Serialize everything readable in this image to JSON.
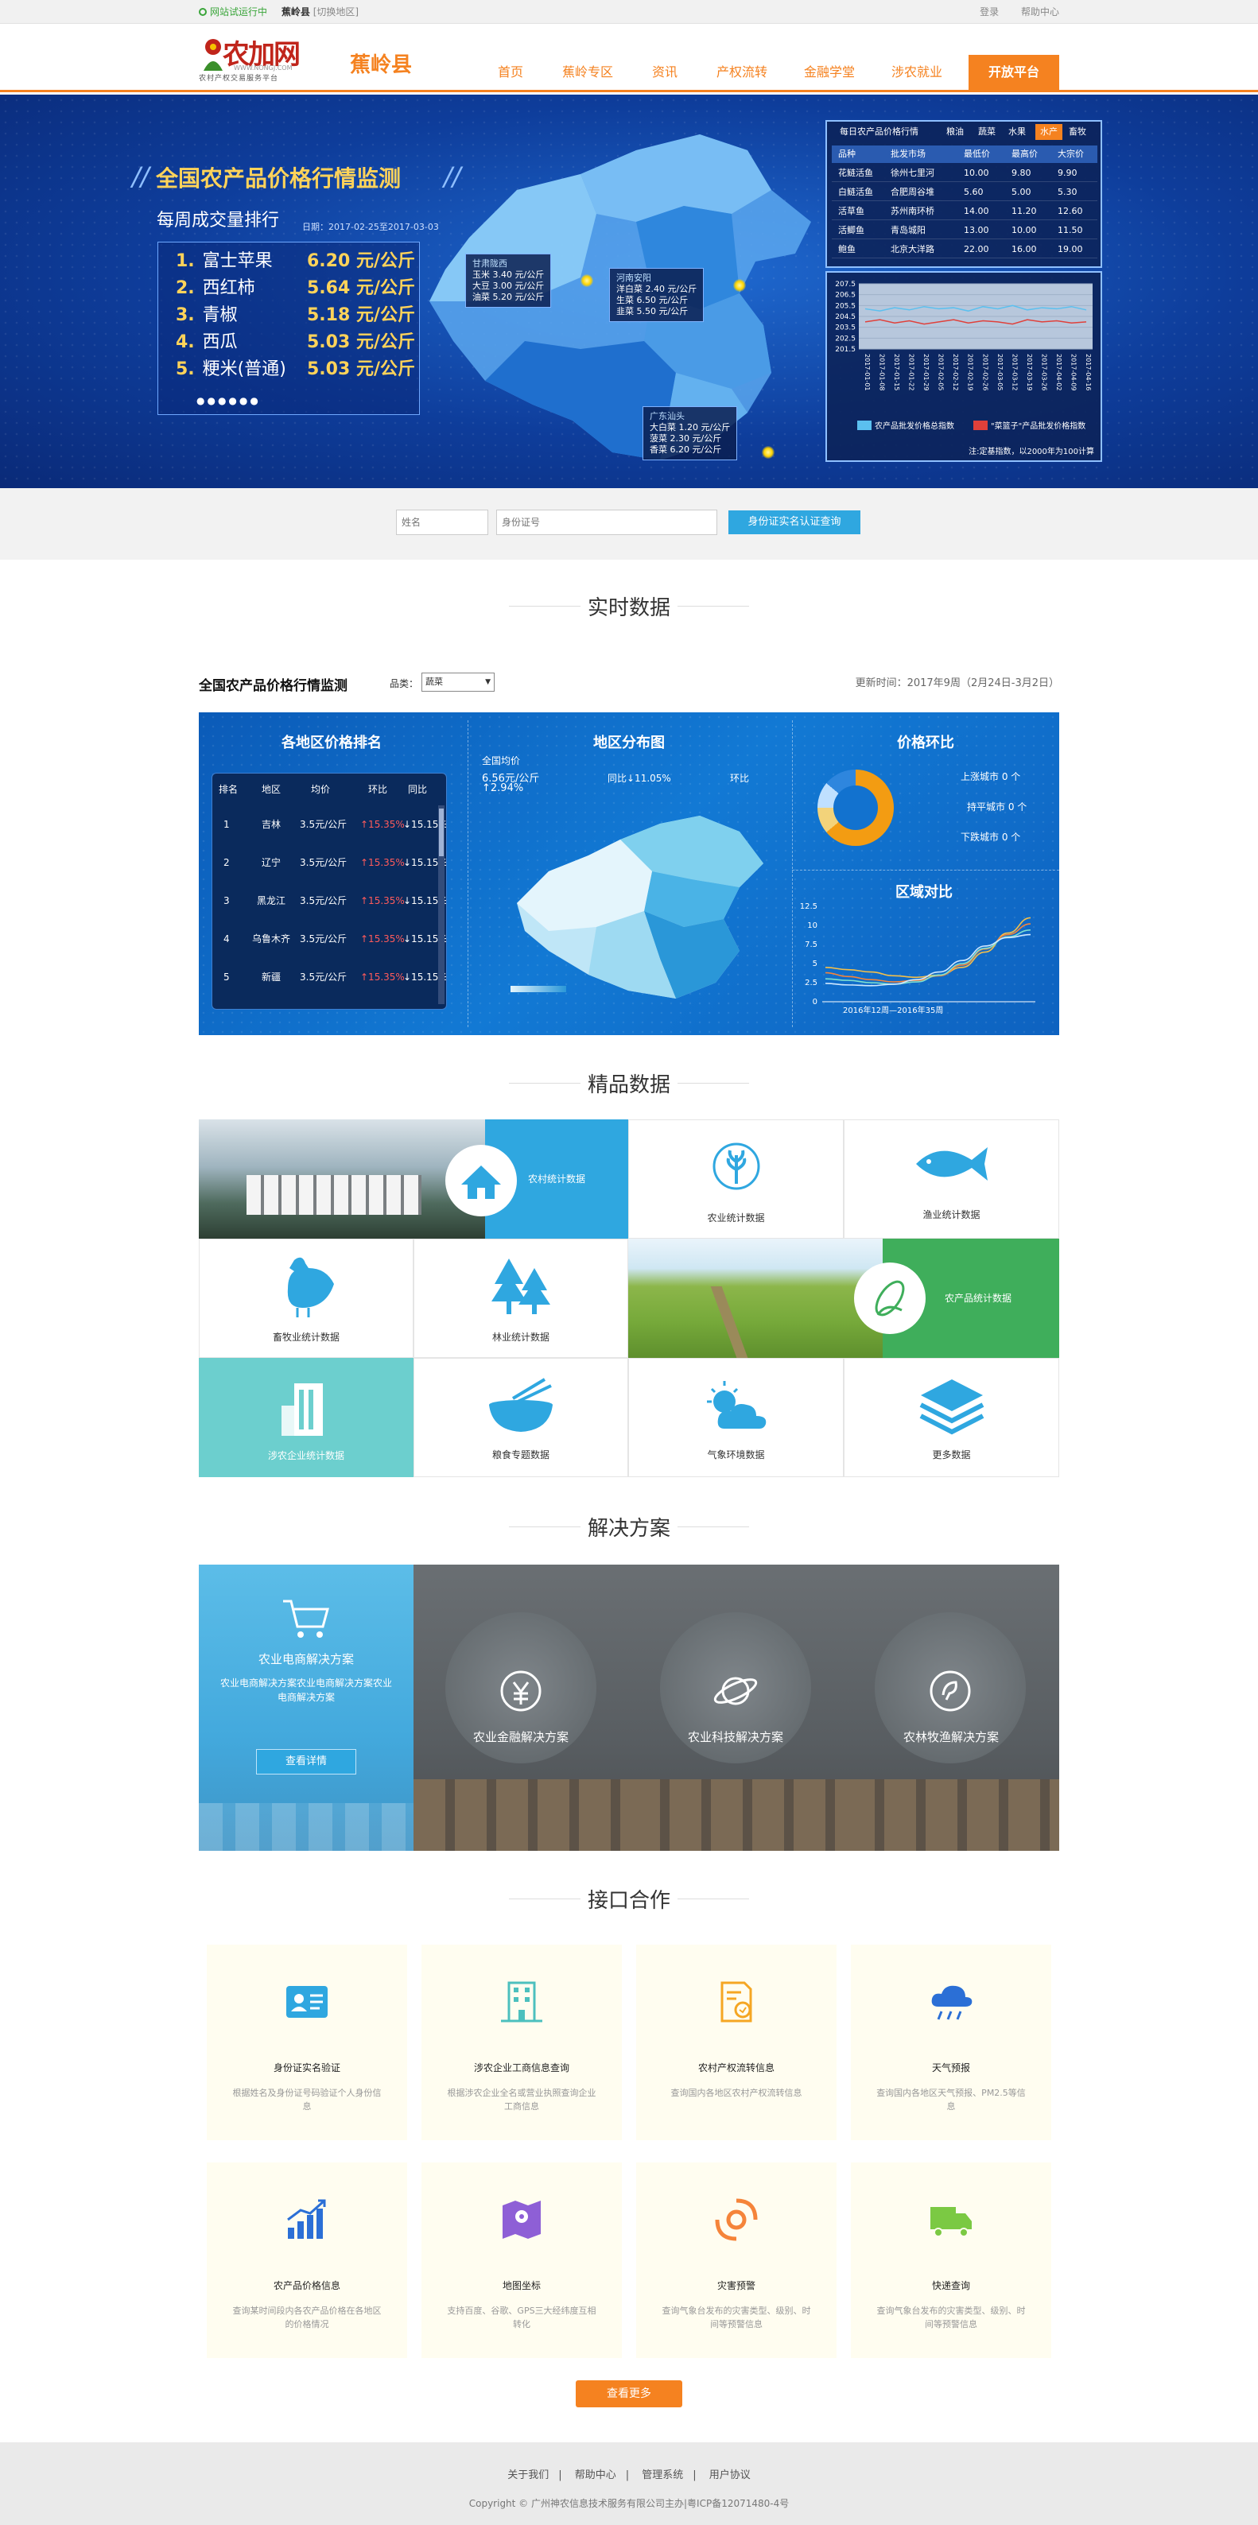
{
  "topbar": {
    "status": "网站试运行中",
    "county": "蕉岭县",
    "switch": "[切换地区]",
    "login": "登录",
    "help": "帮助中心"
  },
  "header": {
    "logo_text": "农加网",
    "logo_url": "WWW.NONGJ.COM",
    "logo_sub": "农村产权交易服务平台",
    "county_title": "蕉岭县",
    "nav": [
      "首页",
      "蕉岭专区",
      "资讯",
      "产权流转",
      "金融学堂",
      "涉农就业",
      "开放平台"
    ],
    "active_nav": "开放平台"
  },
  "banner": {
    "title": "全国农产品价格行情监测",
    "weekly_title": "每周成交量排行",
    "date_range": "日期：2017-02-25至2017-03-03",
    "ranking": [
      {
        "n": "1.",
        "name": "富士苹果",
        "price": "6.20 元/公斤"
      },
      {
        "n": "2.",
        "name": "西红柿",
        "price": "5.64 元/公斤"
      },
      {
        "n": "3.",
        "name": "青椒",
        "price": "5.18 元/公斤"
      },
      {
        "n": "4.",
        "name": "西瓜",
        "price": "5.03 元/公斤"
      },
      {
        "n": "5.",
        "name": "粳米(普通)",
        "price": "5.03 元/公斤"
      }
    ],
    "dots": "●●●●●●",
    "tips": [
      {
        "title": "甘肃陇西",
        "lines": [
          "玉米    3.40 元/公斤",
          "大豆    3.00 元/公斤",
          "油菜    5.20 元/公斤"
        ]
      },
      {
        "title": "河南安阳",
        "lines": [
          "洋白菜    2.40 元/公斤",
          "生菜  6.50 元/公斤",
          "韭菜  5.50 元/公斤"
        ]
      },
      {
        "title": "广东汕头",
        "lines": [
          "大白菜    1.20 元/公斤",
          "菠菜    2.30 元/公斤",
          "香菜    6.20 元/公斤"
        ]
      }
    ],
    "price_panel": {
      "tabs": [
        "每日农产品价格行情",
        "粮油",
        "蔬菜",
        "水果",
        "水产",
        "畜牧"
      ],
      "active_tab": "水产",
      "headers": [
        "品种",
        "批发市场",
        "最低价",
        "最高价",
        "大宗价"
      ],
      "rows": [
        [
          "花鲢活鱼",
          "徐州七里河",
          "10.00",
          "9.80",
          "9.90"
        ],
        [
          "白鲢活鱼",
          "合肥周谷堆",
          "5.60",
          "5.00",
          "5.30"
        ],
        [
          "活草鱼",
          "苏州南环桥",
          "14.00",
          "11.20",
          "12.60"
        ],
        [
          "活鲫鱼",
          "青岛城阳",
          "13.00",
          "10.00",
          "11.50"
        ],
        [
          "鲍鱼",
          "北京大洋路",
          "22.00",
          "16.00",
          "19.00"
        ]
      ]
    },
    "chart_panel": {
      "legend_a": "农产品批发价格总指数",
      "legend_b": "\"菜篮子\"产品批发价格指数",
      "note": "注:定基指数，以2000年为100计算"
    }
  },
  "search": {
    "name_placeholder": "姓名",
    "id_placeholder": "身份证号",
    "button": "身份证实名认证查询"
  },
  "sections": {
    "realtime": "实时数据",
    "premium": "精品数据",
    "solutions": "解决方案",
    "api": "接口合作"
  },
  "realtime": {
    "title": "全国农产品价格行情监测",
    "variety_label": "品类：",
    "variety_value": "蔬菜",
    "updated": "更新时间：2017年9周（2月24日-3月2日）",
    "rank_title": "各地区价格排名",
    "rank_headers": [
      "排名",
      "地区",
      "均价",
      "环比",
      "同比"
    ],
    "rank_rows": [
      [
        "1",
        "吉林",
        "3.5元/公斤",
        "↑15.35%",
        "↓15.15%"
      ],
      [
        "2",
        "辽宁",
        "3.5元/公斤",
        "↑15.35%",
        "↓15.15%"
      ],
      [
        "3",
        "黑龙江",
        "3.5元/公斤",
        "↑15.35%",
        "↓15.15%"
      ],
      [
        "4",
        "乌鲁木齐",
        "3.5元/公斤",
        "↑15.35%",
        "↓15.15%"
      ],
      [
        "5",
        "新疆",
        "3.5元/公斤",
        "↑15.35%",
        "↓15.15%"
      ]
    ],
    "map_title": "地区分布图",
    "national_avg_label": "全国均价",
    "national_avg_value": "6.56元/公斤",
    "national_change": "↑2.94%",
    "yoy": "同比↓11.05%",
    "mom": "环比",
    "trend_title": "价格环比",
    "up_cities": "上涨城市 0 个",
    "flat_cities": "持平城市 0 个",
    "down_cities": "下跌城市 0 个",
    "compare_title": "区域对比",
    "compare_note": "2016年12周—2016年35周"
  },
  "premium": [
    {
      "label": "农村统计数据",
      "icon": "house-icon"
    },
    {
      "label": "农业统计数据",
      "icon": "wheat-icon"
    },
    {
      "label": "渔业统计数据",
      "icon": "fish-icon"
    },
    {
      "label": "畜牧业统计数据",
      "icon": "chicken-icon"
    },
    {
      "label": "林业统计数据",
      "icon": "tree-icon"
    },
    {
      "label": "农产品统计数据",
      "icon": "corn-icon"
    },
    {
      "label": "涉农企业统计数据",
      "icon": "building-icon"
    },
    {
      "label": "粮食专题数据",
      "icon": "bowl-icon"
    },
    {
      "label": "气象环境数据",
      "icon": "weather-icon"
    },
    {
      "label": "更多数据",
      "icon": "layers-icon"
    }
  ],
  "solutions": [
    {
      "label": "农业电商解决方案",
      "desc": "农业电商解决方案农业电商解决方案农业电商解决方案",
      "button": "查看详情"
    },
    {
      "label": "农业金融解决方案"
    },
    {
      "label": "农业科技解决方案"
    },
    {
      "label": "农林牧渔解决方案"
    }
  ],
  "api": [
    {
      "label": "身份证实名验证",
      "desc": "根据姓名及身份证号码验证个人身份信息",
      "icon": "id-card-icon"
    },
    {
      "label": "涉农企业工商信息查询",
      "desc": "根据涉农企业全名或营业执照查询企业工商信息",
      "icon": "building-icon"
    },
    {
      "label": "农村产权流转信息",
      "desc": "查询国内各地区农村产权流转信息",
      "icon": "document-icon"
    },
    {
      "label": "天气预报",
      "desc": "查询国内各地区天气预报、PM2.5等信息",
      "icon": "rain-cloud-icon"
    },
    {
      "label": "农产品价格信息",
      "desc": "查询某时间段内各农产品价格在各地区的价格情况",
      "icon": "bar-chart-icon"
    },
    {
      "label": "地图坐标",
      "desc": "支持百度、谷歌、GPS三大经纬度互相转化",
      "icon": "map-icon"
    },
    {
      "label": "灾害预警",
      "desc": "查询气象台发布的灾害类型、级别、时间等预警信息",
      "icon": "typhoon-icon"
    },
    {
      "label": "快递查询",
      "desc": "查询气象台发布的灾害类型、级别、时间等预警信息",
      "icon": "truck-icon"
    }
  ],
  "api_more": "查看更多",
  "footer": {
    "links": [
      "关于我们",
      "帮助中心",
      "管理系统",
      "用户协议"
    ],
    "copyright": "Copyright © 广州神农信息技术服务有限公司主办|粤ICP备12071480-4号"
  },
  "colors": {
    "brand": "#f58220",
    "blue": "#1279d4",
    "dark_blue": "#0e3d9b"
  },
  "chart_data": [
    {
      "type": "line",
      "title": "",
      "ylim": [
        201.5,
        207.5
      ],
      "yticks": [
        "207.5",
        "206.5",
        "205.5",
        "204.5",
        "203.5",
        "202.5",
        "201.5"
      ],
      "x": [
        "2017-01-01",
        "2017-01-08",
        "2017-01-15",
        "2017-01-22",
        "2017-01-29",
        "2017-02-05",
        "2017-02-12",
        "2017-02-19",
        "2017-02-26",
        "2017-03-05",
        "2017-03-12",
        "2017-03-19",
        "2017-03-26",
        "2017-04-02",
        "2017-04-09",
        "2017-04-16"
      ],
      "series": [
        {
          "name": "农产品批发价格总指数",
          "values": [
            205.2,
            205.0,
            205.3,
            205.1,
            205.4,
            205.2,
            205.3,
            205.0,
            205.4,
            205.2,
            205.5,
            205.1,
            205.3,
            205.2,
            205.4,
            205.1
          ]
        },
        {
          "name": "\"菜篮子\"产品批发价格指数",
          "values": [
            204.0,
            204.2,
            203.9,
            204.1,
            203.8,
            204.0,
            204.2,
            203.9,
            204.1,
            204.0,
            203.8,
            204.2,
            204.0,
            204.1,
            203.9,
            204.0
          ]
        }
      ]
    },
    {
      "type": "line",
      "title": "区域对比",
      "ylim": [
        0,
        12.5
      ],
      "yticks": [
        "12.5",
        "10",
        "7.5",
        "5",
        "2.5",
        "0"
      ],
      "series": [
        {
          "values": [
            4.5,
            4.2,
            3.9,
            3.4,
            3.2,
            3.5,
            4.5,
            6.5,
            9.0,
            11.0
          ]
        },
        {
          "values": [
            3.8,
            3.3,
            2.9,
            2.6,
            2.8,
            3.4,
            4.8,
            6.9,
            8.8,
            10.2
          ]
        },
        {
          "values": [
            3.0,
            2.8,
            2.5,
            2.3,
            2.6,
            3.5,
            5.0,
            7.0,
            8.5,
            9.4
          ]
        },
        {
          "values": [
            2.4,
            2.2,
            2.1,
            2.3,
            2.9,
            3.9,
            5.4,
            7.3,
            8.4,
            8.8
          ]
        }
      ]
    }
  ]
}
